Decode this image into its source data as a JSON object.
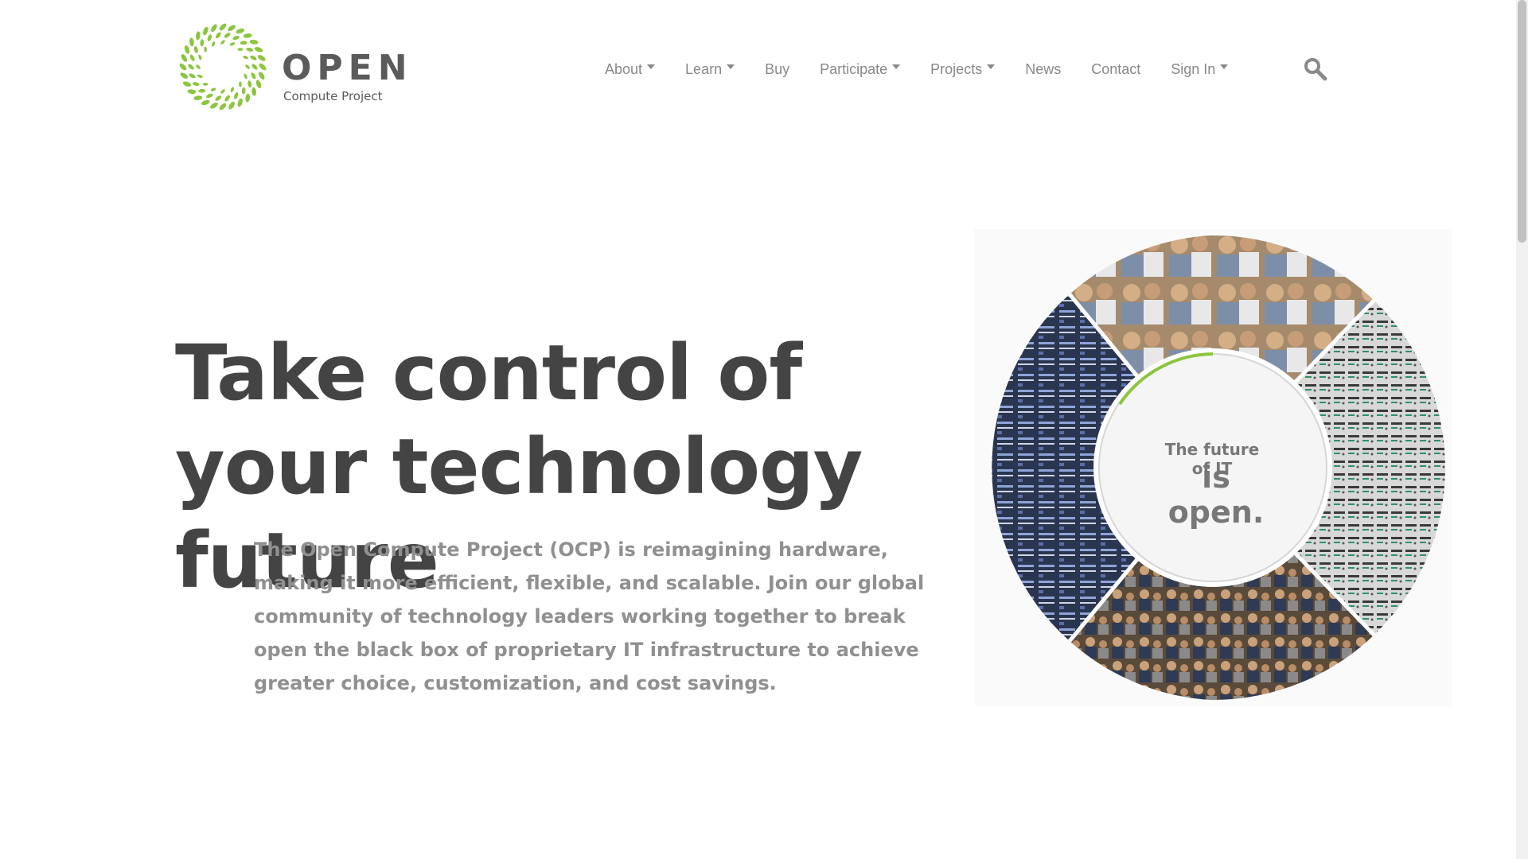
{
  "logo": {
    "word": "OPEN",
    "subtitle": "Compute Project",
    "accent": "#8cc63f"
  },
  "nav": {
    "items": [
      {
        "label": "About",
        "dropdown": true
      },
      {
        "label": "Learn",
        "dropdown": true
      },
      {
        "label": "Buy",
        "dropdown": false
      },
      {
        "label": "Participate",
        "dropdown": true
      },
      {
        "label": "Projects",
        "dropdown": true
      },
      {
        "label": "News",
        "dropdown": false
      },
      {
        "label": "Contact",
        "dropdown": false
      },
      {
        "label": "Sign In",
        "dropdown": true
      }
    ],
    "search_icon": "search-icon"
  },
  "hero": {
    "title": "Take control of your technology future",
    "description": "The Open Compute Project (OCP) is reimagining hardware, making it more efficient, flexible, and scalable. Join our global community of technology leaders working together to break open the black box of proprietary IT infrastructure to achieve greater choice, customization, and cost savings."
  },
  "circle": {
    "tagline_small": "The future of IT",
    "tagline_big": "is open.",
    "accent": "#8cc63f"
  }
}
